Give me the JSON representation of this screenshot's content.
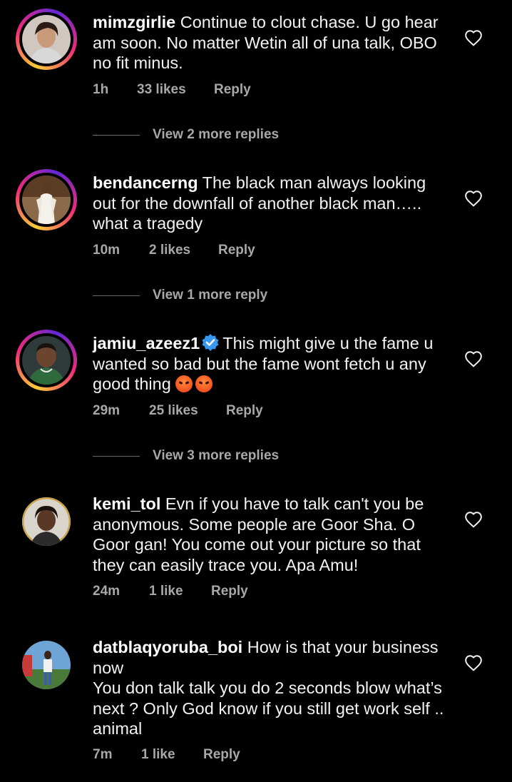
{
  "comments": [
    {
      "username": "mimzgirlie",
      "text": "Continue to clout chase. U go hear am soon. No matter Wetin all of una talk, OBO no fit minus.",
      "time": "1h",
      "likes": "33 likes",
      "reply": "Reply",
      "view_replies": "View 2 more replies",
      "verified": false
    },
    {
      "username": "bendancerng",
      "text": "The black man always looking out for the downfall of another black man….. what a tragedy",
      "time": "10m",
      "likes": "2 likes",
      "reply": "Reply",
      "view_replies": "View 1 more reply",
      "verified": false
    },
    {
      "username": "jamiu_azeez1",
      "text": "This might give u the fame u wanted so bad but the fame wont fetch u any good thing",
      "time": "29m",
      "likes": "25 likes",
      "reply": "Reply",
      "view_replies": "View 3 more replies",
      "verified": true,
      "emojis": [
        "angry-face-emoji",
        "angry-face-emoji"
      ]
    },
    {
      "username": "kemi_tol",
      "text": "Evn if you have to talk can't you be anonymous. Some people are Goor Sha. O Goor gan! You come out your picture so that they can easily trace you. Apa Amu!",
      "time": "24m",
      "likes": "1 like",
      "reply": "Reply",
      "verified": false
    },
    {
      "username": "datblaqyoruba_boi",
      "text": "How is that your business now\nYou don talk talk you do 2 seconds blow what’s next ? Only God know if you still get work self .. animal",
      "time": "7m",
      "likes": "1 like",
      "reply": "Reply",
      "verified": false
    }
  ],
  "icons": {
    "like": "heart-outline-icon",
    "verified": "verified-badge-icon"
  },
  "colors": {
    "background": "#000000",
    "text": "#f2f2f2",
    "meta": "#a8a8a8",
    "verified": "#3897f0"
  }
}
